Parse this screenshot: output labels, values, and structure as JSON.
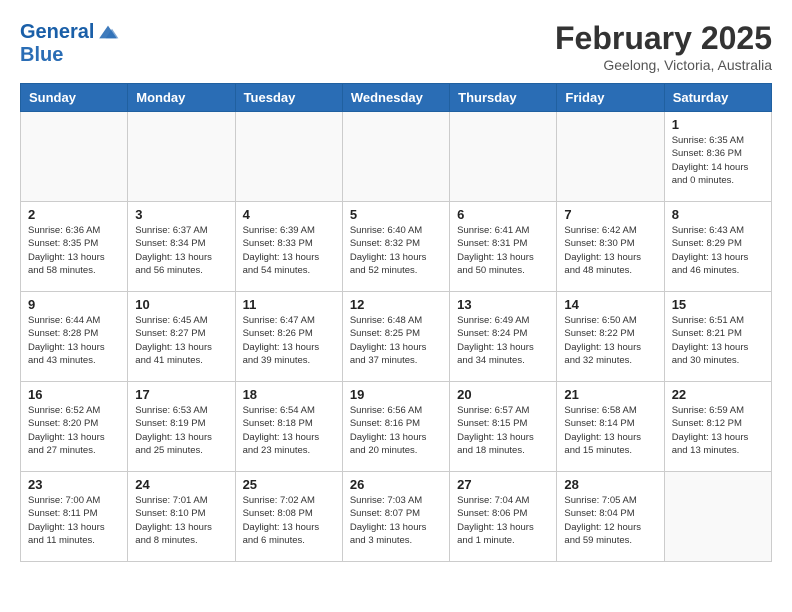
{
  "header": {
    "logo_line1": "General",
    "logo_line2": "Blue",
    "month": "February 2025",
    "location": "Geelong, Victoria, Australia"
  },
  "days_of_week": [
    "Sunday",
    "Monday",
    "Tuesday",
    "Wednesday",
    "Thursday",
    "Friday",
    "Saturday"
  ],
  "weeks": [
    [
      {
        "day": "",
        "info": ""
      },
      {
        "day": "",
        "info": ""
      },
      {
        "day": "",
        "info": ""
      },
      {
        "day": "",
        "info": ""
      },
      {
        "day": "",
        "info": ""
      },
      {
        "day": "",
        "info": ""
      },
      {
        "day": "1",
        "info": "Sunrise: 6:35 AM\nSunset: 8:36 PM\nDaylight: 14 hours\nand 0 minutes."
      }
    ],
    [
      {
        "day": "2",
        "info": "Sunrise: 6:36 AM\nSunset: 8:35 PM\nDaylight: 13 hours\nand 58 minutes."
      },
      {
        "day": "3",
        "info": "Sunrise: 6:37 AM\nSunset: 8:34 PM\nDaylight: 13 hours\nand 56 minutes."
      },
      {
        "day": "4",
        "info": "Sunrise: 6:39 AM\nSunset: 8:33 PM\nDaylight: 13 hours\nand 54 minutes."
      },
      {
        "day": "5",
        "info": "Sunrise: 6:40 AM\nSunset: 8:32 PM\nDaylight: 13 hours\nand 52 minutes."
      },
      {
        "day": "6",
        "info": "Sunrise: 6:41 AM\nSunset: 8:31 PM\nDaylight: 13 hours\nand 50 minutes."
      },
      {
        "day": "7",
        "info": "Sunrise: 6:42 AM\nSunset: 8:30 PM\nDaylight: 13 hours\nand 48 minutes."
      },
      {
        "day": "8",
        "info": "Sunrise: 6:43 AM\nSunset: 8:29 PM\nDaylight: 13 hours\nand 46 minutes."
      }
    ],
    [
      {
        "day": "9",
        "info": "Sunrise: 6:44 AM\nSunset: 8:28 PM\nDaylight: 13 hours\nand 43 minutes."
      },
      {
        "day": "10",
        "info": "Sunrise: 6:45 AM\nSunset: 8:27 PM\nDaylight: 13 hours\nand 41 minutes."
      },
      {
        "day": "11",
        "info": "Sunrise: 6:47 AM\nSunset: 8:26 PM\nDaylight: 13 hours\nand 39 minutes."
      },
      {
        "day": "12",
        "info": "Sunrise: 6:48 AM\nSunset: 8:25 PM\nDaylight: 13 hours\nand 37 minutes."
      },
      {
        "day": "13",
        "info": "Sunrise: 6:49 AM\nSunset: 8:24 PM\nDaylight: 13 hours\nand 34 minutes."
      },
      {
        "day": "14",
        "info": "Sunrise: 6:50 AM\nSunset: 8:22 PM\nDaylight: 13 hours\nand 32 minutes."
      },
      {
        "day": "15",
        "info": "Sunrise: 6:51 AM\nSunset: 8:21 PM\nDaylight: 13 hours\nand 30 minutes."
      }
    ],
    [
      {
        "day": "16",
        "info": "Sunrise: 6:52 AM\nSunset: 8:20 PM\nDaylight: 13 hours\nand 27 minutes."
      },
      {
        "day": "17",
        "info": "Sunrise: 6:53 AM\nSunset: 8:19 PM\nDaylight: 13 hours\nand 25 minutes."
      },
      {
        "day": "18",
        "info": "Sunrise: 6:54 AM\nSunset: 8:18 PM\nDaylight: 13 hours\nand 23 minutes."
      },
      {
        "day": "19",
        "info": "Sunrise: 6:56 AM\nSunset: 8:16 PM\nDaylight: 13 hours\nand 20 minutes."
      },
      {
        "day": "20",
        "info": "Sunrise: 6:57 AM\nSunset: 8:15 PM\nDaylight: 13 hours\nand 18 minutes."
      },
      {
        "day": "21",
        "info": "Sunrise: 6:58 AM\nSunset: 8:14 PM\nDaylight: 13 hours\nand 15 minutes."
      },
      {
        "day": "22",
        "info": "Sunrise: 6:59 AM\nSunset: 8:12 PM\nDaylight: 13 hours\nand 13 minutes."
      }
    ],
    [
      {
        "day": "23",
        "info": "Sunrise: 7:00 AM\nSunset: 8:11 PM\nDaylight: 13 hours\nand 11 minutes."
      },
      {
        "day": "24",
        "info": "Sunrise: 7:01 AM\nSunset: 8:10 PM\nDaylight: 13 hours\nand 8 minutes."
      },
      {
        "day": "25",
        "info": "Sunrise: 7:02 AM\nSunset: 8:08 PM\nDaylight: 13 hours\nand 6 minutes."
      },
      {
        "day": "26",
        "info": "Sunrise: 7:03 AM\nSunset: 8:07 PM\nDaylight: 13 hours\nand 3 minutes."
      },
      {
        "day": "27",
        "info": "Sunrise: 7:04 AM\nSunset: 8:06 PM\nDaylight: 13 hours\nand 1 minute."
      },
      {
        "day": "28",
        "info": "Sunrise: 7:05 AM\nSunset: 8:04 PM\nDaylight: 12 hours\nand 59 minutes."
      },
      {
        "day": "",
        "info": ""
      }
    ]
  ]
}
